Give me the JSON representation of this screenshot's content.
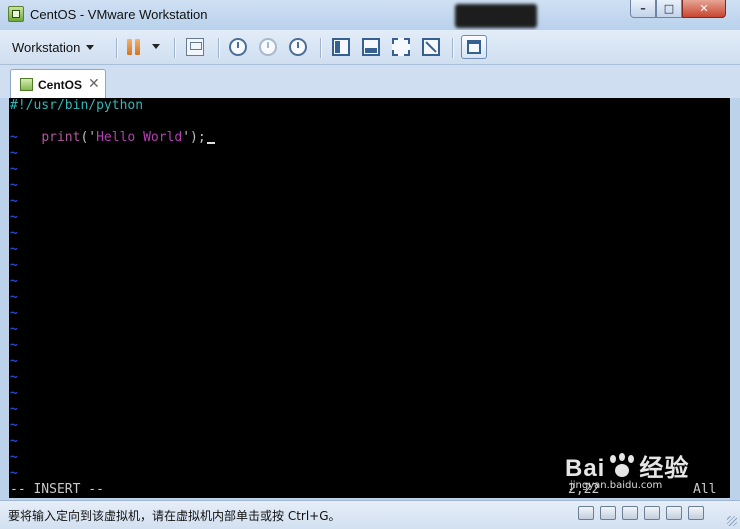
{
  "window": {
    "title": "CentOS - VMware Workstation",
    "controls": {
      "minimize": "–",
      "maximize": "□",
      "close": "✕"
    }
  },
  "toolbar": {
    "workstation_menu": "Workstation",
    "icons": [
      "pause-icon",
      "dropdown-icon",
      "send-ctrl-alt-del-icon",
      "take-snapshot-icon",
      "revert-snapshot-icon",
      "snapshot-manager-icon",
      "console-view-icon",
      "quick-switch-icon",
      "full-screen-icon",
      "unity-icon",
      "thumbnail-view-icon"
    ]
  },
  "tabs": [
    {
      "label": "CentOS",
      "close": "✕"
    }
  ],
  "console": {
    "line1": "#!/usr/bin/python",
    "line2_fn": "print",
    "line2_open": "('",
    "line2_str": "Hello World",
    "line2_close": "');",
    "tilde": "~",
    "mode": "-- INSERT --",
    "position": "2,22",
    "scroll": "All"
  },
  "status": {
    "message": "要将输入定向到该虚拟机，请在虚拟机内部单击或按 Ctrl+G。"
  },
  "watermark": {
    "left": "Bai",
    "right": "经验",
    "url": "jingyan.baidu.com"
  }
}
